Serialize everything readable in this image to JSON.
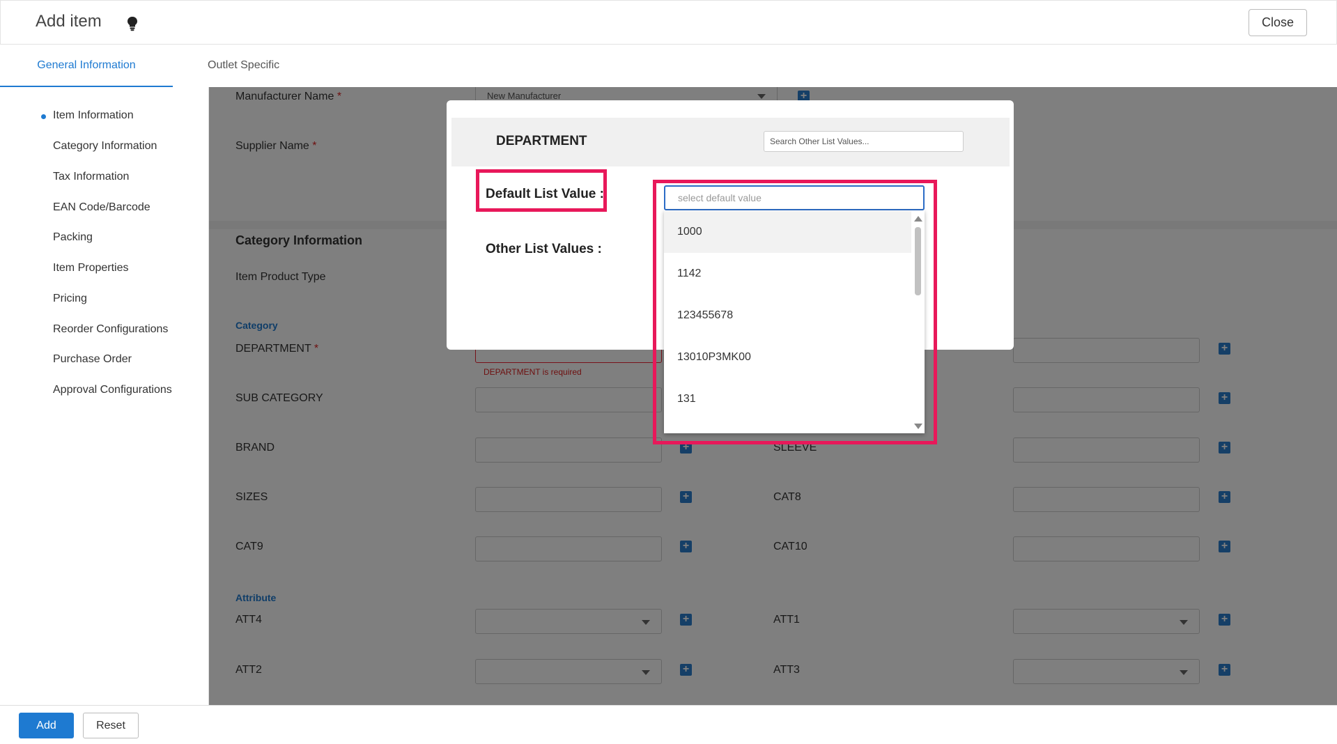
{
  "header": {
    "title": "Add item",
    "close_label": "Close"
  },
  "tabs": [
    {
      "label": "General Information",
      "active": true
    },
    {
      "label": "Outlet Specific",
      "active": false
    }
  ],
  "sidebar": {
    "items": [
      {
        "label": "Item Information",
        "active": true
      },
      {
        "label": "Category Information"
      },
      {
        "label": "Tax Information"
      },
      {
        "label": "EAN Code/Barcode"
      },
      {
        "label": "Packing"
      },
      {
        "label": "Item Properties"
      },
      {
        "label": "Pricing"
      },
      {
        "label": "Reorder Configurations"
      },
      {
        "label": "Purchase Order"
      },
      {
        "label": "Approval Configurations"
      }
    ]
  },
  "form": {
    "manufacturer_label": "Manufacturer Name",
    "manufacturer_value": "New Manufacturer",
    "supplier_label": "Supplier Name",
    "required_mark": "*",
    "category_section_title": "Category Information",
    "item_product_type_label": "Item Product Type",
    "category_subtitle": "Category",
    "department_label": "DEPARTMENT",
    "department_error": "DEPARTMENT is required",
    "sub_category_label": "SUB CATEGORY",
    "brand_label": "BRAND",
    "sleeve_label": "SLEEVE",
    "sizes_label": "SIZES",
    "cat8_label": "CAT8",
    "cat9_label": "CAT9",
    "cat10_label": "CAT10",
    "attribute_subtitle": "Attribute",
    "att4_label": "ATT4",
    "att1_label": "ATT1",
    "att2_label": "ATT2",
    "att3_label": "ATT3"
  },
  "modal": {
    "title": "DEPARTMENT",
    "search_placeholder": "Search Other List Values...",
    "default_label": "Default List Value :",
    "other_label": "Other List Values :",
    "default_placeholder": "select default value",
    "options": [
      "1000",
      "1142",
      "123455678",
      "13010P3MK00",
      "131"
    ]
  },
  "footer": {
    "add_label": "Add",
    "reset_label": "Reset"
  },
  "colors": {
    "accent": "#1e7ad1",
    "highlight": "#e8185a",
    "error": "#dd2222"
  }
}
